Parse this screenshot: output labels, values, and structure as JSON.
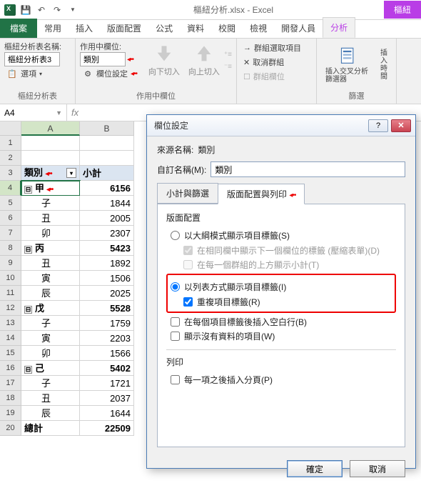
{
  "app": {
    "title": "樞紐分析.xlsx - Excel",
    "context_tab": "樞紐"
  },
  "tabs": {
    "file": "檔案",
    "home": "常用",
    "insert": "插入",
    "layout": "版面配置",
    "formula": "公式",
    "data": "資料",
    "review": "校閱",
    "view": "檢視",
    "developer": "開發人員",
    "analyze": "分析"
  },
  "ribbon": {
    "pt_name_lbl": "樞紐分析表名稱:",
    "pt_name_val": "樞紐分析表3",
    "options": "選項",
    "active_field_lbl": "作用中欄位:",
    "active_field_val": "類別",
    "field_settings": "欄位設定",
    "drill_down": "向下切入",
    "drill_up": "向上切入",
    "group_sel": "群組選取項目",
    "ungroup": "取消群組",
    "group_field": "群組欄位",
    "insert_slicer": "插入交叉分析篩選器",
    "insert_timeline": "插入時間",
    "grp_pt": "樞紐分析表",
    "grp_af": "作用中欄位",
    "grp_filter": "篩選"
  },
  "cellref": "A4",
  "cols": {
    "A": "A",
    "B": "B"
  },
  "rows": [
    {
      "n": "1",
      "a": "",
      "b": ""
    },
    {
      "n": "2",
      "a": "",
      "b": ""
    },
    {
      "n": "3",
      "a": "類別",
      "b": "小計",
      "header": true
    },
    {
      "n": "4",
      "a": "甲",
      "b": "6156",
      "exp": "⊟",
      "bold": true,
      "active": true,
      "arrow": true
    },
    {
      "n": "5",
      "a": "子",
      "b": "1844"
    },
    {
      "n": "6",
      "a": "丑",
      "b": "2005"
    },
    {
      "n": "7",
      "a": "卯",
      "b": "2307"
    },
    {
      "n": "8",
      "a": "丙",
      "b": "5423",
      "exp": "⊟",
      "bold": true
    },
    {
      "n": "9",
      "a": "丑",
      "b": "1892"
    },
    {
      "n": "10",
      "a": "寅",
      "b": "1506"
    },
    {
      "n": "11",
      "a": "辰",
      "b": "2025"
    },
    {
      "n": "12",
      "a": "戊",
      "b": "5528",
      "exp": "⊟",
      "bold": true
    },
    {
      "n": "13",
      "a": "子",
      "b": "1759"
    },
    {
      "n": "14",
      "a": "寅",
      "b": "2203"
    },
    {
      "n": "15",
      "a": "卯",
      "b": "1566"
    },
    {
      "n": "16",
      "a": "己",
      "b": "5402",
      "exp": "⊟",
      "bold": true
    },
    {
      "n": "17",
      "a": "子",
      "b": "1721"
    },
    {
      "n": "18",
      "a": "丑",
      "b": "2037"
    },
    {
      "n": "19",
      "a": "辰",
      "b": "1644"
    },
    {
      "n": "20",
      "a": "總計",
      "b": "22509",
      "bold": true,
      "total": true
    }
  ],
  "dialog": {
    "title": "欄位設定",
    "source_lbl": "來源名稱:",
    "source_val": "類別",
    "custom_lbl": "自訂名稱(M):",
    "custom_val": "類別",
    "tab1": "小計與篩選",
    "tab2": "版面配置與列印",
    "section_layout": "版面配置",
    "opt1": "以大綱模式顯示項目標籤(S)",
    "chk1": "在相同欄中顯示下一個欄位的標籤 (壓縮表單)(D)",
    "chk2": "在每一個群組的上方顯示小計(T)",
    "opt2": "以列表方式顯示項目標籤(I)",
    "chk3": "重複項目標籤(R)",
    "chk4": "在每個項目標籤後插入空白行(B)",
    "chk5": "顯示沒有資料的項目(W)",
    "section_print": "列印",
    "chk6": "每一項之後插入分頁(P)",
    "ok": "確定",
    "cancel": "取消"
  }
}
